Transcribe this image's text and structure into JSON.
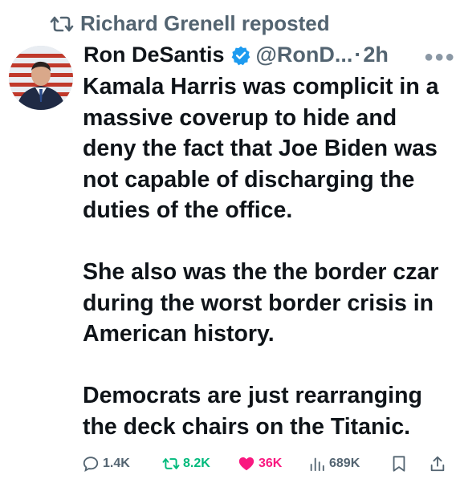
{
  "repost": {
    "label": "Richard Grenell reposted"
  },
  "author": {
    "display_name": "Ron DeSantis",
    "handle": "@RonD...",
    "separator": "·",
    "time": "2h",
    "verified": true,
    "verified_color": "#1d9bf0"
  },
  "tweet": {
    "paragraphs": [
      "Kamala Harris was complicit in a massive coverup to hide and deny the fact that Joe Biden was not capable of discharging the duties of the office.",
      "She also was the the border czar during the worst border crisis in American history.",
      "Democrats are just rearranging the deck chairs on the Titanic."
    ]
  },
  "actions": {
    "replies": "1.4K",
    "reposts": "8.2K",
    "likes": "36K",
    "views": "689K",
    "reposted_color": "#00ba7c",
    "liked_color": "#f91880"
  },
  "icons": {
    "repost": "repost-icon",
    "verified": "verified-badge-icon",
    "more": "more-icon",
    "reply": "reply-icon",
    "like": "heart-icon",
    "views": "views-icon",
    "bookmark": "bookmark-icon",
    "share": "share-icon"
  }
}
